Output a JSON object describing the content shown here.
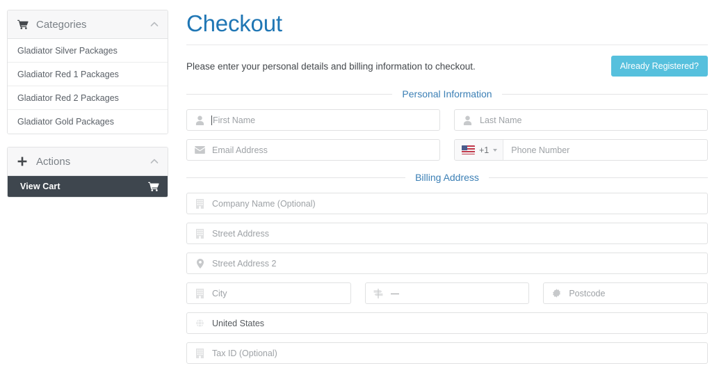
{
  "sidebar": {
    "categories_panel": {
      "icon": "shopping-cart-icon",
      "title": "Categories",
      "collapse_icon": "chevron-up-icon",
      "items": [
        {
          "label": "Gladiator Silver Packages"
        },
        {
          "label": "Gladiator Red 1 Packages"
        },
        {
          "label": "Gladiator Red 2 Packages"
        },
        {
          "label": "Gladiator Gold Packages"
        }
      ]
    },
    "actions_panel": {
      "icon": "plus-icon",
      "title": "Actions",
      "collapse_icon": "chevron-up-icon",
      "view_cart": {
        "label": "View Cart",
        "icon": "shopping-cart-icon"
      }
    }
  },
  "main": {
    "page_title": "Checkout",
    "intro_text": "Please enter your personal details and billing information to checkout.",
    "registered_button": "Already Registered?",
    "personal_information": {
      "legend": "Personal Information",
      "first_name": {
        "placeholder": "First Name",
        "value": "",
        "icon": "user-icon",
        "focused": true
      },
      "last_name": {
        "placeholder": "Last Name",
        "value": "",
        "icon": "user-icon"
      },
      "email": {
        "placeholder": "Email Address",
        "value": "",
        "icon": "envelope-icon"
      },
      "phone": {
        "placeholder": "Phone Number",
        "value": "",
        "country_flag": "us-flag-icon",
        "dial_code": "+1",
        "dropdown_icon": "caret-down-icon"
      }
    },
    "billing_address": {
      "legend": "Billing Address",
      "company": {
        "placeholder": "Company Name (Optional)",
        "value": "",
        "icon": "building-icon"
      },
      "street1": {
        "placeholder": "Street Address",
        "value": "",
        "icon": "building-icon"
      },
      "street2": {
        "placeholder": "Street Address 2",
        "value": "",
        "icon": "map-marker-icon"
      },
      "city": {
        "placeholder": "City",
        "value": "",
        "icon": "building-icon"
      },
      "state": {
        "placeholder": "—",
        "value": "—",
        "icon": "map-signs-icon"
      },
      "postcode": {
        "placeholder": "Postcode",
        "value": "",
        "icon": "cog-icon"
      },
      "country": {
        "placeholder": "United States",
        "value": "United States",
        "icon": "globe-icon"
      },
      "tax_id": {
        "placeholder": "Tax ID (Optional)",
        "value": "",
        "icon": "building-icon"
      }
    }
  },
  "colors": {
    "title_blue": "#1f76b4",
    "legend_blue": "#3b7fb5",
    "info_button": "#56c0dd",
    "dark_button": "#3e464e",
    "border": "#e0e1e2"
  }
}
